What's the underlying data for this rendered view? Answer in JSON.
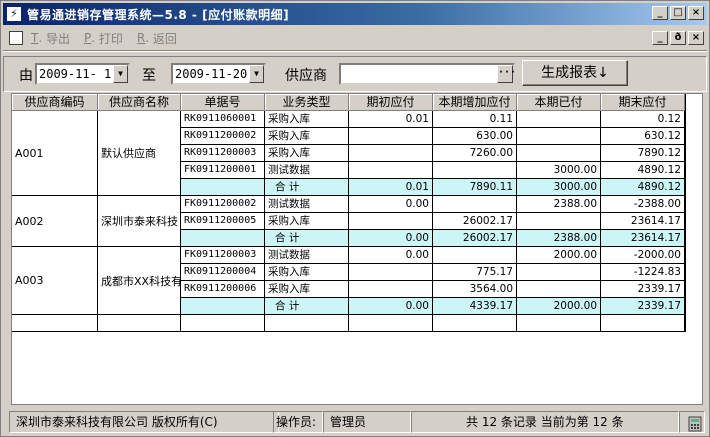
{
  "window": {
    "title": "管易通进销存管理系统—5.8 - [应付账款明细]",
    "controls": [
      "_",
      "□",
      "×"
    ],
    "mdi_controls": [
      "_",
      "ð",
      "×"
    ]
  },
  "menu": {
    "items": [
      {
        "key": "T",
        "label": "导出"
      },
      {
        "key": "P",
        "label": "打印"
      },
      {
        "key": "R",
        "label": "返回"
      }
    ]
  },
  "filter": {
    "from_label": "由",
    "from_date": "2009-11- 1",
    "to_label": "至",
    "to_date": "2009-11-20",
    "supplier_label": "供应商",
    "supplier_value": "",
    "generate_label": "生成报表↓"
  },
  "table": {
    "headers": [
      "供应商编码",
      "供应商名称",
      "单据号",
      "业务类型",
      "期初应付",
      "本期增加应付",
      "本期已付",
      "期末应付"
    ],
    "groups": [
      {
        "code": "A001",
        "name": "默认供应商",
        "rows": [
          [
            "RK0911060001",
            "采购入库",
            "0.01",
            "0.11",
            "",
            "0.12"
          ],
          [
            "RK0911200002",
            "采购入库",
            "",
            "630.00",
            "",
            "630.12"
          ],
          [
            "RK0911200003",
            "采购入库",
            "",
            "7260.00",
            "",
            "7890.12"
          ],
          [
            "FK0911200001",
            "测试数据",
            "",
            "",
            "3000.00",
            "4890.12"
          ]
        ],
        "total": [
          "",
          "合  计",
          "0.01",
          "7890.11",
          "3000.00",
          "4890.12"
        ]
      },
      {
        "code": "A002",
        "name": "深圳市泰来科技",
        "rows": [
          [
            "FK0911200002",
            "测试数据",
            "0.00",
            "",
            "2388.00",
            "-2388.00"
          ],
          [
            "RK0911200005",
            "采购入库",
            "",
            "26002.17",
            "",
            "23614.17"
          ]
        ],
        "total": [
          "",
          "合  计",
          "0.00",
          "26002.17",
          "2388.00",
          "23614.17"
        ]
      },
      {
        "code": "A003",
        "name": "成都市XX科技有",
        "rows": [
          [
            "FK0911200003",
            "测试数据",
            "0.00",
            "",
            "2000.00",
            "-2000.00"
          ],
          [
            "RK0911200004",
            "采购入库",
            "",
            "775.17",
            "",
            "-1224.83"
          ],
          [
            "RK0911200006",
            "采购入库",
            "",
            "3564.00",
            "",
            "2339.17"
          ]
        ],
        "total": [
          "",
          "合  计",
          "0.00",
          "4339.17",
          "2000.00",
          "2339.17"
        ]
      }
    ]
  },
  "status": {
    "company": "深圳市泰来科技有限公司 版权所有(C)",
    "operator_label": "操作员:",
    "operator": "管理员",
    "records": "共 12 条记录 当前为第 12 条"
  },
  "colors": {
    "title_gradient_start": "#0a246a",
    "total_row_bg": "#ccf6f6"
  }
}
